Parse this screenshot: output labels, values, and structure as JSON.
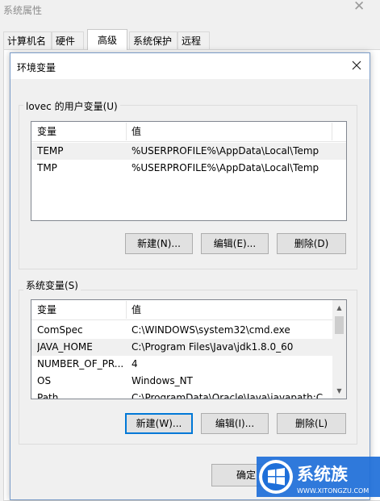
{
  "background_window": {
    "title": "系统属性",
    "close_glyph": "✕",
    "tabs": [
      {
        "label": "计算机名"
      },
      {
        "label": "硬件"
      },
      {
        "label": "高级"
      },
      {
        "label": "系统保护"
      },
      {
        "label": "远程"
      }
    ],
    "active_tab": "高级",
    "ok_label": "确定"
  },
  "dialog": {
    "title": "环境变量",
    "user_vars": {
      "group_label": "lovec 的用户变量(U)",
      "columns": [
        "变量",
        "值"
      ],
      "rows": [
        {
          "name": "TEMP",
          "value": "%USERPROFILE%\\AppData\\Local\\Temp"
        },
        {
          "name": "TMP",
          "value": "%USERPROFILE%\\AppData\\Local\\Temp"
        }
      ],
      "buttons": {
        "new": "新建(N)...",
        "edit": "编辑(E)...",
        "delete": "删除(D)"
      }
    },
    "system_vars": {
      "group_label": "系统变量(S)",
      "columns": [
        "变量",
        "值"
      ],
      "rows": [
        {
          "name": "ComSpec",
          "value": "C:\\WINDOWS\\system32\\cmd.exe"
        },
        {
          "name": "JAVA_HOME",
          "value": "C:\\Program Files\\Java\\jdk1.8.0_60"
        },
        {
          "name": "NUMBER_OF_PR...",
          "value": "4"
        },
        {
          "name": "OS",
          "value": "Windows_NT"
        },
        {
          "name": "Path",
          "value": "C:\\ProgramData\\Oracle\\Java\\javapath;C"
        }
      ],
      "buttons": {
        "new": "新建(W)...",
        "edit": "编辑(I)...",
        "delete": "删除(L)"
      }
    }
  },
  "watermark": {
    "brand": "系统族",
    "url": "WWW.XITONGZU.COM",
    "colors": {
      "blue": "#1e6fd9",
      "white": "#ffffff"
    }
  },
  "colors": {
    "focus_border": "#0078d7",
    "selected_row": "#f0f0f0",
    "dialog_border": "#7a9cc8"
  },
  "icons": {
    "dialog_close": "close-icon",
    "scroll_up": "scroll-up-arrow-icon",
    "scroll_down": "scroll-down-arrow-icon"
  }
}
